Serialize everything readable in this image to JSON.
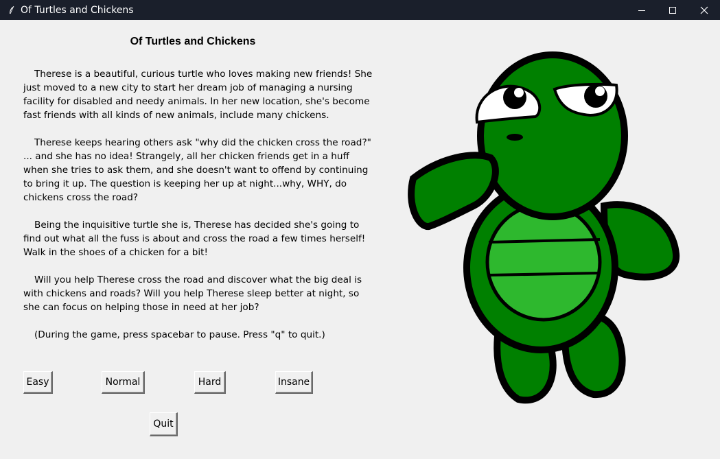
{
  "window": {
    "title": "Of Turtles and Chickens",
    "icons": [
      "feather-icon",
      "minimize-icon",
      "maximize-icon",
      "close-icon"
    ]
  },
  "main": {
    "heading": "Of Turtles and Chickens",
    "paragraphs": [
      "Therese is a beautiful, curious turtle who loves making new friends! She just moved to a new city to start her dream job of managing a nursing facility for disabled and needy animals. In her new location, she's become fast friends with all kinds of new animals, include many chickens.",
      "Therese keeps hearing others ask \"why did the chicken cross the road?\" ... and she has no idea! Strangely, all her chicken friends get in a huff when she tries to ask them, and she doesn't want to offend by continuing to bring it up. The question is keeping her up at night...why, WHY, do chickens cross the road?",
      "Being the inquisitive turtle she is, Therese has decided she's going to find out what all the fuss is about and cross the road a few times herself! Walk in the shoes of a chicken for a bit!",
      "Will you help Therese cross the road and discover what the big deal is with chickens and roads? Will you help Therese sleep better at night, so she can focus on helping those in need at her job?",
      "(During the game, press spacebar to pause. Press \"q\" to quit.)"
    ]
  },
  "buttons": {
    "easy": "Easy",
    "normal": "Normal",
    "hard": "Hard",
    "insane": "Insane",
    "quit": "Quit"
  },
  "colors": {
    "titlebar": "#1a1f2b",
    "background": "#f0f0f0",
    "turtle_dark_green": "#008000",
    "turtle_light_green": "#2eb82e"
  }
}
